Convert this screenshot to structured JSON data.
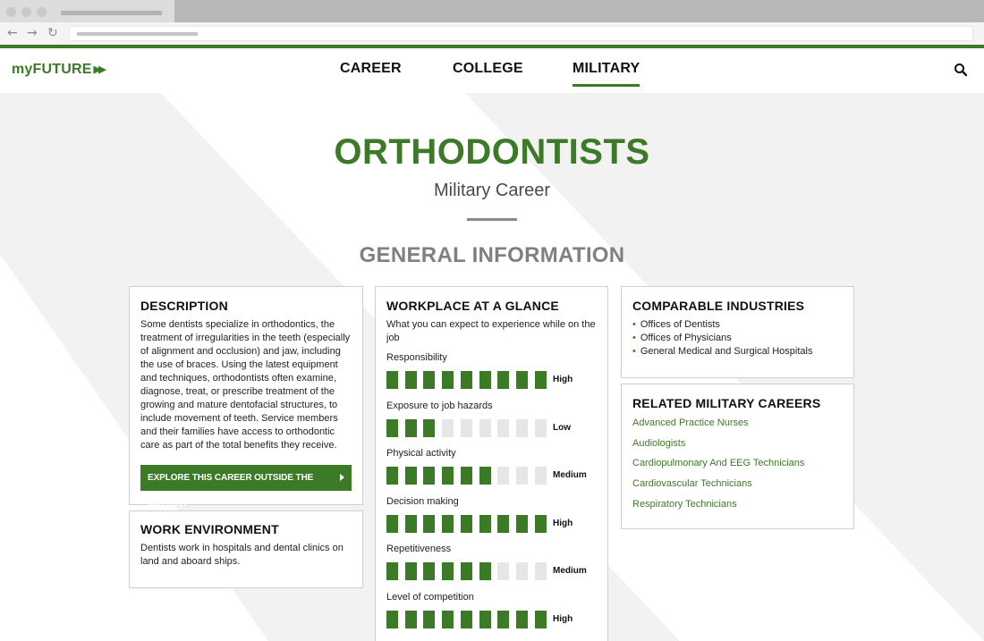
{
  "site": {
    "logo": "myFUTURE",
    "logo_arrows": "▶▶",
    "nav": [
      {
        "label": "CAREER",
        "active": false
      },
      {
        "label": "COLLEGE",
        "active": false
      },
      {
        "label": "MILITARY",
        "active": true
      }
    ],
    "accent_color": "#3d7a28"
  },
  "page": {
    "title": "ORTHODONTISTS",
    "subtitle": "Military Career",
    "section_heading": "GENERAL INFORMATION"
  },
  "description": {
    "title": "DESCRIPTION",
    "lines": [
      "Some dentists specialize in orthodontics, the",
      "treatment of irregularities in the teeth (especially",
      "of alignment and occlusion) and jaw, including",
      "the use of braces. Using the latest equipment",
      "and techniques, orthodontists often examine,",
      "diagnose, treat, or prescribe treatment of the",
      "growing and mature dentofacial structures, to",
      "include movement of teeth. Service members",
      "and their families have access to orthodontic",
      "care as part of the total benefits they receive."
    ],
    "button_label": "EXPLORE THIS CAREER OUTSIDE THE MILITARY"
  },
  "work_environment": {
    "title": "WORK ENVIRONMENT",
    "lines": [
      "Dentists work in hospitals and dental clinics on",
      "land and aboard ships."
    ]
  },
  "workplace": {
    "title": "WORKPLACE AT A GLANCE",
    "intro_lines": [
      "What you can expect to experience while on the",
      "job"
    ],
    "metrics": [
      {
        "label": "Responsibility",
        "level": "High",
        "filled": 9,
        "total": 9
      },
      {
        "label": "Exposure to job hazards",
        "level": "Low",
        "filled": 3,
        "total": 9
      },
      {
        "label": "Physical activity",
        "level": "Medium",
        "filled": 6,
        "total": 9
      },
      {
        "label": "Decision making",
        "level": "High",
        "filled": 9,
        "total": 9
      },
      {
        "label": "Repetitiveness",
        "level": "Medium",
        "filled": 6,
        "total": 9
      },
      {
        "label": "Level of competition",
        "level": "High",
        "filled": 9,
        "total": 9
      }
    ]
  },
  "industries": {
    "title": "COMPARABLE INDUSTRIES",
    "items": [
      "Offices of Dentists",
      "Offices of Physicians",
      "General Medical and Surgical Hospitals"
    ]
  },
  "related": {
    "title": "RELATED MILITARY CAREERS",
    "items": [
      "Advanced Practice Nurses",
      "Audiologists",
      "Cardiopulmonary And EEG Technicians",
      "Cardiovascular Technicians",
      "Respiratory Technicians"
    ]
  }
}
